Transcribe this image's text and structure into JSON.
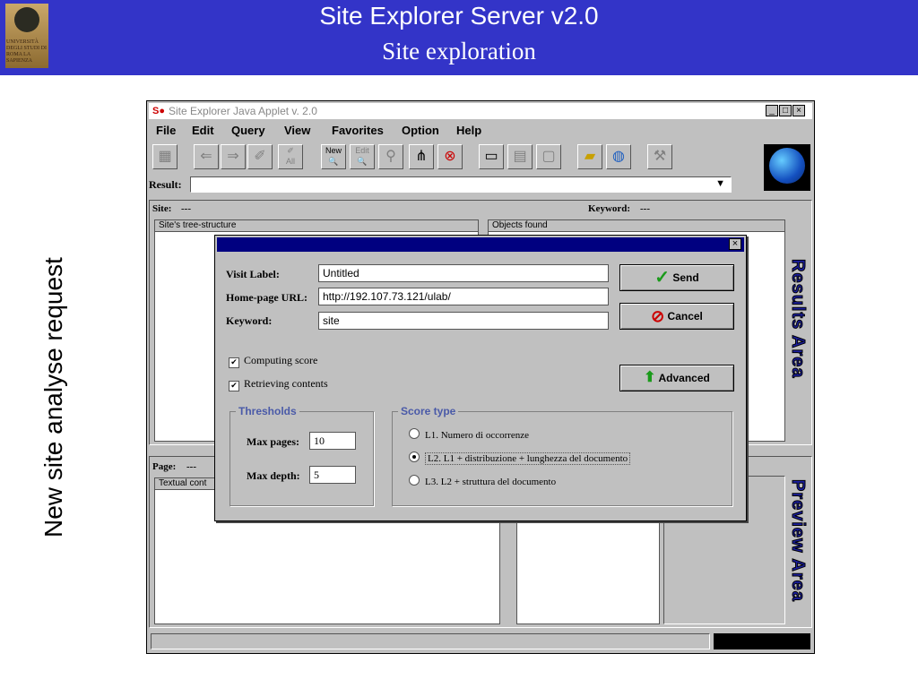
{
  "slide": {
    "title": "Site Explorer Server v2.0",
    "subtitle": "Site exploration",
    "side_caption": "New site analyse request",
    "logo_text": "UNIVERSITÀ DEGLI STUDI DI ROMA LA SAPIENZA"
  },
  "window": {
    "title": "Site Explorer Java Applet v. 2.0",
    "controls": [
      "_",
      "□",
      "×"
    ],
    "menu": [
      "File",
      "Edit",
      "Query",
      "View",
      "Favorites",
      "Option",
      "Help"
    ],
    "toolbar": {
      "new_label": "New",
      "edit_label": "Edit",
      "all_label": "All"
    },
    "result_label": "Result:",
    "site_label": "Site:",
    "site_value": "---",
    "keyword_label": "Keyword:",
    "keyword_value": "---",
    "tree_header": "Site's tree-structure",
    "objects_header": "Objects found",
    "page_label": "Page:",
    "page_value": "---",
    "textual_header": "Textual cont",
    "results_area": "Results Area",
    "preview_area": "Preview Area"
  },
  "dialog": {
    "close": "×",
    "visit_label": "Visit Label:",
    "visit_value": "Untitled",
    "url_label": "Home-page URL:",
    "url_value": "http://192.107.73.121/ulab/",
    "keyword_label": "Keyword:",
    "keyword_value": "site",
    "send": "Send",
    "cancel": "Cancel",
    "advanced": "Advanced",
    "computing_score": "Computing score",
    "computing_checked": true,
    "retrieving_contents": "Retrieving contents",
    "retrieving_checked": true,
    "thresholds_title": "Thresholds",
    "max_pages_label": "Max pages:",
    "max_pages_value": "10",
    "max_depth_label": "Max depth:",
    "max_depth_value": "5",
    "score_title": "Score type",
    "score_options": [
      "L1. Numero di occorrenze",
      "L2. L1 + distribuzione + lunghezza del documento",
      "L3. L2 + struttura del documento"
    ],
    "score_selected": "L2. L1 + distribuzione + lunghezza del documento"
  },
  "colors": {
    "slide_header": "#3334c8",
    "dialog_titlebar": "#000080",
    "send_check": "#1a9a1a",
    "cancel_icon": "#cc0000",
    "advanced_arrow": "#1a9a1a",
    "area_text": "#1b1fa0"
  }
}
